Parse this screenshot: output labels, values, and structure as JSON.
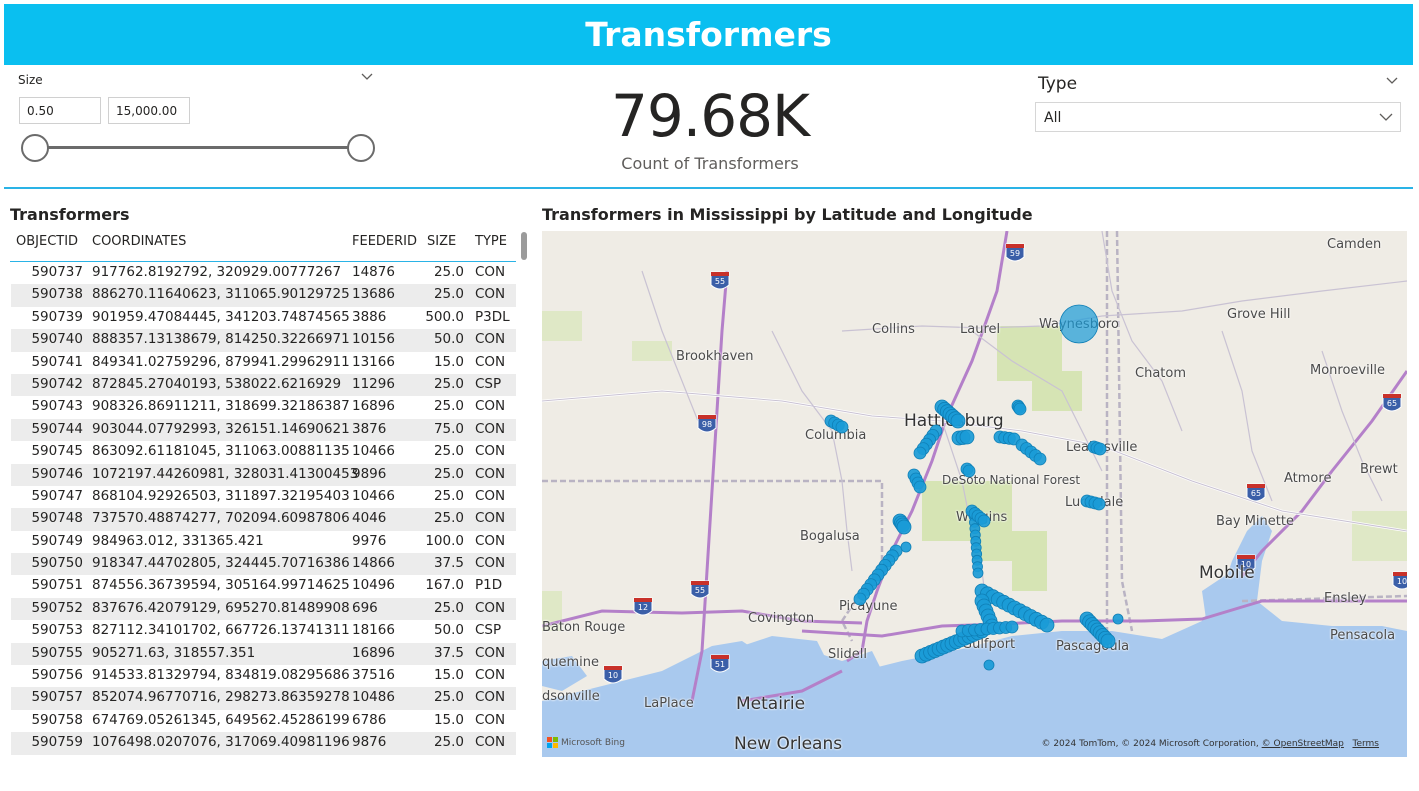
{
  "header": {
    "title": "Transformers"
  },
  "size_slicer": {
    "title": "Size",
    "min_value": "0.50",
    "max_value": "15,000.00",
    "range_fraction": [
      0.0,
      1.0
    ]
  },
  "card": {
    "value": "79.68K",
    "label": "Count of Transformers"
  },
  "type_slicer": {
    "title": "Type",
    "selected": "All"
  },
  "table": {
    "title": "Transformers",
    "columns": [
      "OBJECTID",
      "COORDINATES",
      "FEEDERID",
      "SIZE",
      "TYPE"
    ],
    "rows": [
      [
        "590737",
        "917762.8192792, 320929.00777267",
        "14876",
        "25.0",
        "CON"
      ],
      [
        "590738",
        "886270.11640623, 311065.90129725",
        "13686",
        "25.0",
        "CON"
      ],
      [
        "590739",
        "901959.47084445, 341203.74874565",
        "3886",
        "500.0",
        "P3DL"
      ],
      [
        "590740",
        "888357.13138679, 814250.32266971",
        "10156",
        "50.0",
        "CON"
      ],
      [
        "590741",
        "849341.02759296, 879941.29962911",
        "13166",
        "15.0",
        "CON"
      ],
      [
        "590742",
        "872845.27040193, 538022.6216929",
        "11296",
        "25.0",
        "CSP"
      ],
      [
        "590743",
        "908326.86911211, 318699.32186387",
        "16896",
        "25.0",
        "CON"
      ],
      [
        "590744",
        "903044.07792993, 326151.14690621",
        "3876",
        "75.0",
        "CON"
      ],
      [
        "590745",
        "863092.61181045, 311063.00881135",
        "10466",
        "25.0",
        "CON"
      ],
      [
        "590746",
        "1072197.44260981, 328031.41300453",
        "9896",
        "25.0",
        "CON"
      ],
      [
        "590747",
        "868104.92926503, 311897.32195403",
        "10466",
        "25.0",
        "CON"
      ],
      [
        "590748",
        "737570.48874277, 702094.60987806",
        "4046",
        "25.0",
        "CON"
      ],
      [
        "590749",
        "984963.012, 331365.421",
        "9976",
        "100.0",
        "CON"
      ],
      [
        "590750",
        "918347.44702805, 324445.70716386",
        "14866",
        "37.5",
        "CON"
      ],
      [
        "590751",
        "874556.36739594, 305164.99714625",
        "10496",
        "167.0",
        "P1D"
      ],
      [
        "590752",
        "837676.42079129, 695270.81489908",
        "696",
        "25.0",
        "CON"
      ],
      [
        "590753",
        "827112.34101702, 667726.13741311",
        "18166",
        "50.0",
        "CSP"
      ],
      [
        "590755",
        "905271.63, 318557.351",
        "16896",
        "37.5",
        "CON"
      ],
      [
        "590756",
        "914533.81329794, 834819.08295686",
        "37516",
        "15.0",
        "CON"
      ],
      [
        "590757",
        "852074.96770716, 298273.86359278",
        "10486",
        "25.0",
        "CON"
      ],
      [
        "590758",
        "674769.05261345, 649562.45286199",
        "6786",
        "15.0",
        "CON"
      ],
      [
        "590759",
        "1076498.0207076, 317069.40981196",
        "9876",
        "25.0",
        "CON"
      ]
    ]
  },
  "map": {
    "title": "Transformers in Mississippi by Latitude and Longitude",
    "place_labels": {
      "camden": "Camden",
      "collins": "Collins",
      "laurel": "Laurel",
      "waynesboro": "Waynesboro",
      "grove_hill": "Grove Hill",
      "brookhaven": "Brookhaven",
      "chatom": "Chatom",
      "monroeville": "Monroeville",
      "hattiesburg": "Hattiesburg",
      "columbia": "Columbia",
      "leakesville": "Leakesville",
      "brewton": "Brewt",
      "desoto": "DeSoto National Forest",
      "atmore": "Atmore",
      "lucedale": "Lucedale",
      "bogalusa": "Bogalusa",
      "wiggins": "Wiggins",
      "bay_minette": "Bay Minette",
      "mobile": "Mobile",
      "picayune": "Picayune",
      "ensley": "Ensley",
      "covington": "Covington",
      "baton_rouge": "Baton Rouge",
      "pensacola": "Pensacola",
      "slidell": "Slidell",
      "gulfport": "Gulfport",
      "pascagoula": "Pascagoula",
      "plaquemine": "quemine",
      "donaldsonville": "dsonville",
      "laplace": "LaPlace",
      "metairie": "Metairie",
      "new_orleans": "New Orleans"
    },
    "highway_shields": [
      "59",
      "55",
      "98",
      "65",
      "65",
      "12",
      "55",
      "10",
      "51",
      "10",
      "10"
    ],
    "attribution": "© 2024 TomTom, © 2024 Microsoft Corporation,",
    "attribution_link": "© OpenStreetMap",
    "terms": "Terms",
    "provider": "Microsoft Bing",
    "marker_color": "#1a9bd7"
  }
}
